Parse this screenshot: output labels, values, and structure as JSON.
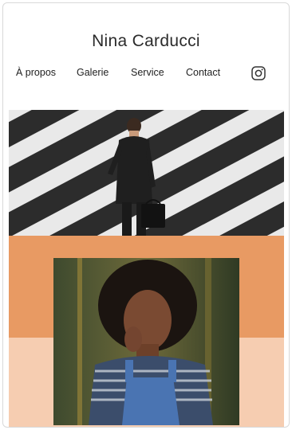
{
  "site": {
    "title": "Nina Carducci"
  },
  "nav": {
    "items": [
      "À propos",
      "Galerie",
      "Service",
      "Contact"
    ]
  },
  "social": {
    "icon": "instagram-icon"
  },
  "colors": {
    "accent_dark": "#e89a63",
    "accent_light": "#f6cdb1",
    "text": "#2b2b2b"
  }
}
